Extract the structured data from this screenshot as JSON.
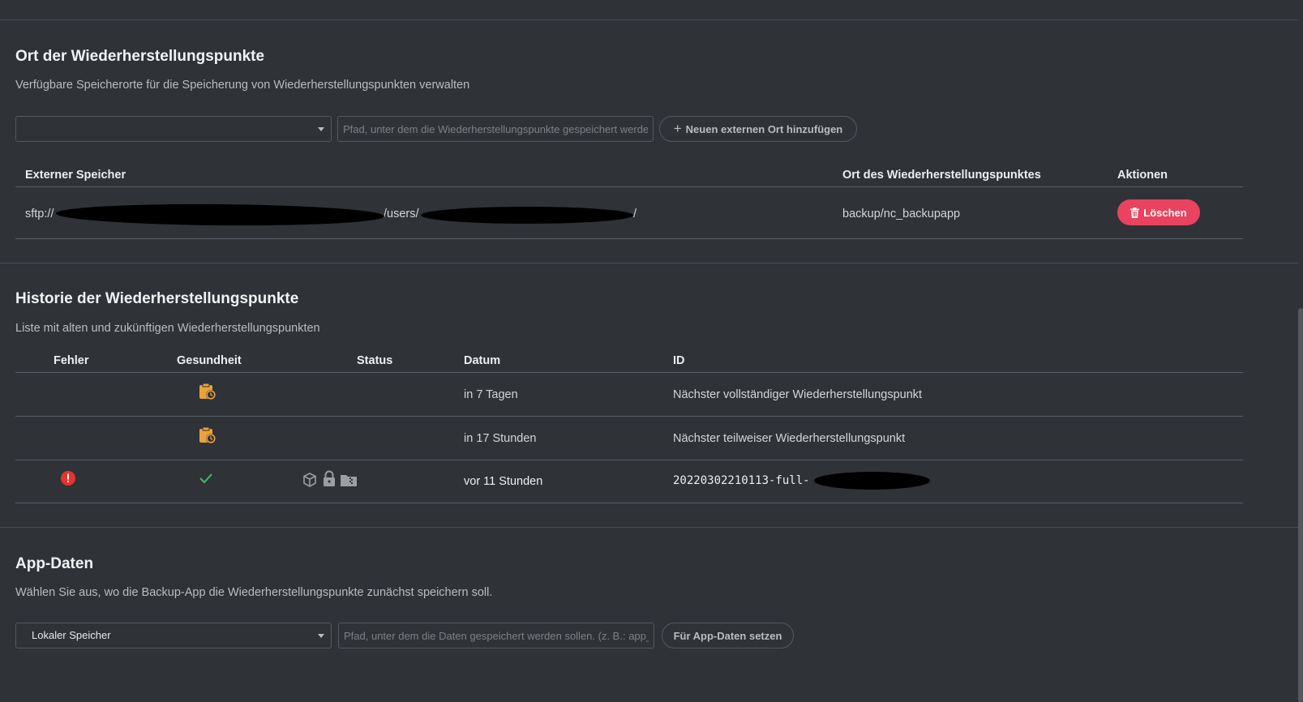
{
  "locations": {
    "title": "Ort der Wiederherstellungspunkte",
    "description": "Verfügbare Speicherorte für die Speicherung von Wiederherstellungspunkten verwalten",
    "select_value": "",
    "path_placeholder": "Pfad, unter dem die Wiederherstellungspunkte gespeichert werden sollen",
    "add_button_label": "Neuen externen Ort hinzufügen",
    "columns": [
      "Externer Speicher",
      "Ort des Wiederherstellungspunktes",
      "Aktionen"
    ],
    "rows": [
      {
        "storage_prefix": "sftp://",
        "storage_middle": "/users/",
        "storage_suffix": "/",
        "location": "backup/nc_backupapp",
        "delete_label": "Löschen"
      }
    ]
  },
  "history": {
    "title": "Historie der Wiederherstellungspunkte",
    "description": "Liste mit alten und zukünftigen Wiederherstellungspunkten",
    "columns": [
      "Fehler",
      "Gesundheit",
      "Status",
      "Datum",
      "ID"
    ],
    "rows": [
      {
        "date": "in 7 Tagen",
        "id": "Nächster vollständiger Wiederherstellungspunkt",
        "health_icon": "clipboard-clock-icon"
      },
      {
        "date": "in 17 Stunden",
        "id": "Nächster teilweiser Wiederherstellungspunkt",
        "health_icon": "clipboard-clock-icon"
      },
      {
        "date": "vor 11 Stunden",
        "id": "20220302210113-full-",
        "error_icon": "error-icon",
        "health_icon": "check-icon",
        "status_icons": [
          "package-icon",
          "lock-icon",
          "archive-icon"
        ]
      }
    ]
  },
  "appdata": {
    "title": "App-Daten",
    "description": "Wählen Sie aus, wo die Backup-App die Wiederherstellungspunkte zunächst speichern soll.",
    "select_value": "Lokaler Speicher",
    "path_placeholder": "Pfad, unter dem die Daten gespeichert werden sollen. (z. B.: app_data)",
    "set_button_label": "Für App-Daten setzen"
  },
  "colors": {
    "background": "#2f3237",
    "danger": "#e9435f",
    "warning": "#e9a23b",
    "success": "#46ba61",
    "error": "#e9322d"
  }
}
